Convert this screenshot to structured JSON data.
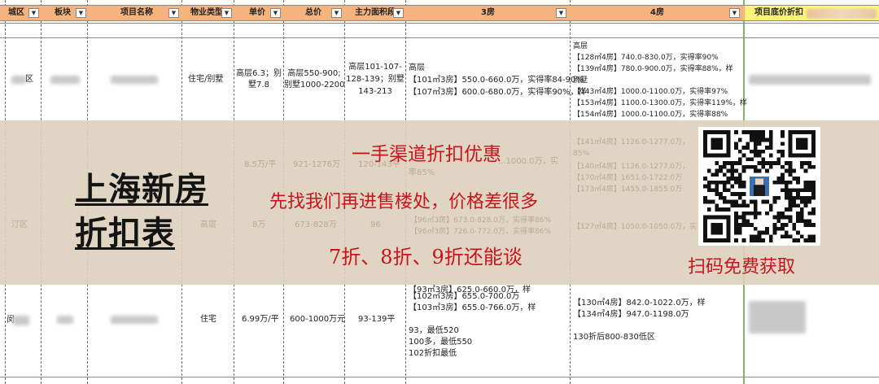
{
  "header": {
    "col_district": "城区",
    "col_block": "板块",
    "col_project": "项目名称",
    "col_type": "物业类型",
    "col_unit_price": "单价",
    "col_total": "总价",
    "col_main_area": "主力面积段",
    "col_3room": "3房",
    "col_4room": "4房",
    "col_bottom_discount": "项目底价折扣"
  },
  "row1": {
    "district_suffix": "区",
    "type": "住宅/别墅",
    "unit_price_l1": "高层6.3；别",
    "unit_price_l2": "墅7.8",
    "total_l1": "高层550-900;",
    "total_l2": "别墅1000-2200",
    "area_l1": "高层101-107-",
    "area_l2": "128-139；别墅",
    "area_l3": "143-213",
    "room3": [
      "高层",
      "【101㎡3房】550.0-660.0万，实得率84-90%",
      "【107㎡3房】600.0-680.0万，实得率90%，样"
    ],
    "room4": [
      "高层",
      "【128㎡4房】740.0-830.0万，实得率90%",
      "【139㎡4房】780.0-900.0万，实得率88%，样",
      "别墅",
      "【143㎡4房】1000.0-1100.0万，实得率97%",
      "【153㎡4房】1100.0-1300.0万，实得率119%，样",
      "【154㎡4房】1000.0-1100.0万，实得率88%"
    ]
  },
  "row2_faint": {
    "unit_price": "8.5万/平",
    "total": "921-1276万",
    "area": "120-143平",
    "room3_l1": "...1000.0万，",
    "room3_l2": "实",
    "room3_l3": "率85%",
    "room4_l0": "【141㎡4房】1126.0-1277.0万，",
    "room4_l1": "85%",
    "room4_l2": "【140㎡4房】1126.0-1277.0万，",
    "room4_l3": "【170㎡4房】1651.0-1722.0万",
    "room4_l4": "【173㎡4房】1455.0-1855.0万"
  },
  "row3_faint": {
    "district_suffix": "汀区",
    "type": "高层",
    "unit_price": "8万",
    "total": "673-828万",
    "area": "96",
    "room3_l1": "【96㎡3房】673.0-828.0万，实得率86%",
    "room3_l2": "【96㎡3房】726.0-772.0万，实得率86%",
    "room4_l1": "【127㎡4房】1050.0-1050.0万，实"
  },
  "row4": {
    "district_prefix": "闵",
    "type": "住宅",
    "unit_price": "6.99万/平",
    "total": "600-1000万元",
    "area": "93-139平",
    "room3": [
      "【93㎡3房】625.0-660.0万，样",
      "【102㎡3房】655.0-700.0万",
      "【103㎡3房】655.0-766.0万，样",
      "",
      "93，最低520",
      "100多，最低550",
      "102折扣最低"
    ],
    "room4": [
      "【130㎡4房】842.0-1022.0万，样",
      "【134㎡4房】947.0-1198.0万",
      "",
      "130折后800-830低区"
    ]
  },
  "ad": {
    "title_line1": "上海新房",
    "title_line2": "折扣表",
    "slogan1": "一手渠道折扣优惠",
    "slogan2": "先找我们再进售楼处，价格差很多",
    "slogan3": "7折、8折、9折还能谈",
    "scan_text": "扫码免费获取",
    "accent_color": "#c8141d",
    "banner_color": "#ddd0bc"
  }
}
